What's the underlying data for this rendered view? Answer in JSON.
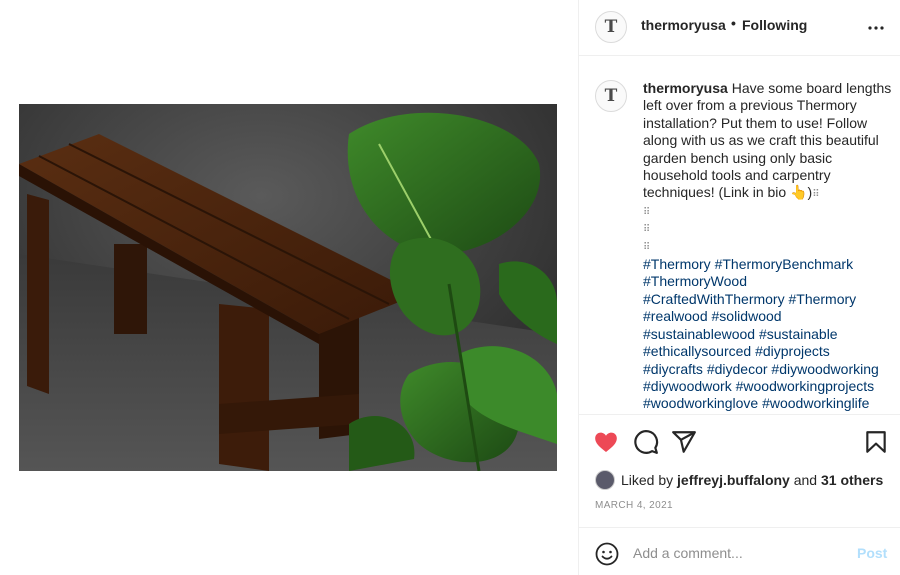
{
  "post": {
    "username": "thermoryusa",
    "separator": "•",
    "follow_status": "Following",
    "avatar_letter": "T",
    "caption": {
      "username": "thermoryusa",
      "text": "Have some board lengths left over from a previous Thermory installation? Put them to use! Follow along with us as we craft this beautiful garden bench using only basic household tools and carpentry techniques! (Link in bio 👆)",
      "dots": "⠿",
      "hashtags": [
        "#Thermory",
        "#ThermoryBenchmark",
        "#ThermoryWood",
        "#CraftedWithThermory",
        "#Thermory",
        "#realwood",
        "#solidwood",
        "#sustainablewood",
        "#sustainable",
        "#ethicallysourced",
        "#diyprojects",
        "#diycrafts",
        "#diydecor",
        "#diywoodworking",
        "#diywoodwork",
        "#woodworkingprojects",
        "#woodworkinglove",
        "#woodworkinglife"
      ]
    },
    "likes": {
      "prefix": "Liked by",
      "user": "jeffreyj.buffalony",
      "and": "and",
      "others": "31 others"
    },
    "date": "MARCH 4, 2021",
    "comment": {
      "placeholder": "Add a comment...",
      "post_label": "Post"
    },
    "icons": {
      "more": "more-options-icon",
      "heart": "heart-icon",
      "comment": "comment-icon",
      "share": "share-icon",
      "save": "bookmark-icon",
      "emoji": "emoji-icon"
    },
    "colors": {
      "heart": "#ed4956",
      "hashtag": "#00376b",
      "post_button": "#b2dffc",
      "muted": "#8e8e8e"
    }
  }
}
